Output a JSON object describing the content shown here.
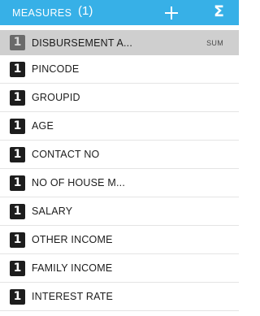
{
  "header": {
    "title": "MEASURES",
    "count": "(1)",
    "add_icon": "plus-icon",
    "sum_icon_glyph": "Σ",
    "background_color": "#37b0e7"
  },
  "measures": [
    {
      "badge": "1",
      "label": "DISBURSEMENT A...",
      "aggregation": "SUM",
      "selected": true
    },
    {
      "badge": "1",
      "label": "PINCODE"
    },
    {
      "badge": "1",
      "label": "GROUPID"
    },
    {
      "badge": "1",
      "label": "AGE"
    },
    {
      "badge": "1",
      "label": "CONTACT NO"
    },
    {
      "badge": "1",
      "label": "NO OF HOUSE M..."
    },
    {
      "badge": "1",
      "label": "SALARY"
    },
    {
      "badge": "1",
      "label": "OTHER INCOME"
    },
    {
      "badge": "1",
      "label": "FAMILY INCOME"
    },
    {
      "badge": "1",
      "label": "INTEREST RATE"
    }
  ]
}
